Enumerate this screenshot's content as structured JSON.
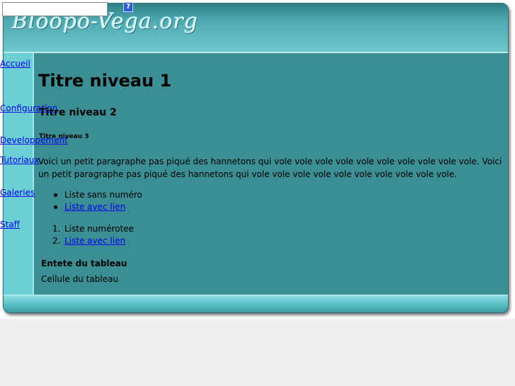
{
  "site": {
    "logo_text": "Bloopo-Vega.org"
  },
  "search": {
    "value": "",
    "help_glyph": "?"
  },
  "nav": {
    "items": [
      {
        "label": "Accueil"
      },
      {
        "label": "Configuration"
      },
      {
        "label": "Developpement"
      },
      {
        "label": "Tutoriaux"
      },
      {
        "label": "Galeries"
      },
      {
        "label": "Staff"
      }
    ]
  },
  "content": {
    "h1": "Titre niveau 1",
    "h2": "Titre niveau 2",
    "h3": "Titre niveau 3",
    "paragraph": "Voici un petit paragraphe pas piqué des hannetons qui vole vole vole vole vole vole vole vole vole vole. Voici un petit paragraphe pas piqué des hannetons qui vole vole vole vole vole vole vole vole vole vole.",
    "unordered_list": [
      {
        "label": "Liste sans numéro",
        "link": false
      },
      {
        "label": "Liste avec lien",
        "link": true
      }
    ],
    "ordered_list": [
      {
        "number": "1.",
        "label": "Liste numérotee",
        "link": false
      },
      {
        "number": "2.",
        "label": "Liste avec lien",
        "link": true
      }
    ],
    "table": {
      "header": "Entete du tableau",
      "cell": "Cellule du tableau"
    }
  },
  "colors": {
    "frame": "#3a8e94",
    "sidebar": "#6dcfd6",
    "link": "#0000ee"
  }
}
